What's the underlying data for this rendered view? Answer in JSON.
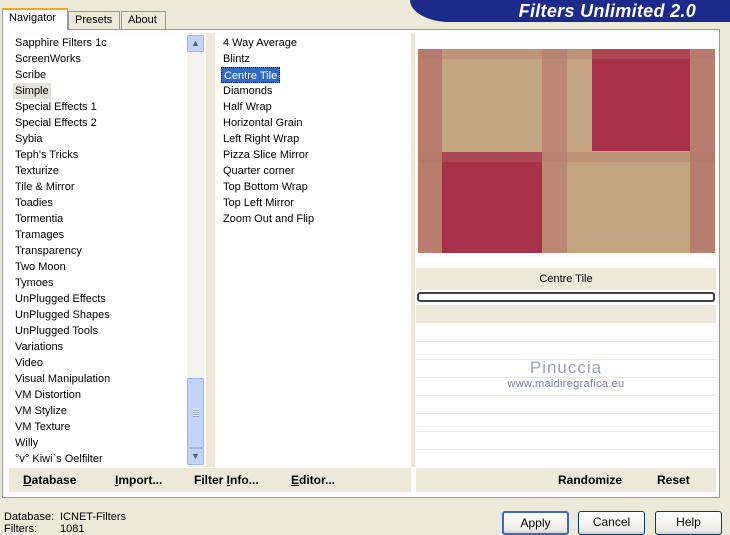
{
  "banner": {
    "title": "Filters Unlimited 2.0"
  },
  "tabs": [
    {
      "label": "Navigator"
    },
    {
      "label": "Presets"
    },
    {
      "label": "About"
    }
  ],
  "categories": {
    "selected": "Simple",
    "items": [
      "Sapphire Filters 1c",
      "ScreenWorks",
      "Scribe",
      "Simple",
      "Special Effects 1",
      "Special Effects 2",
      "Sybia",
      "Teph's Tricks",
      "Texturize",
      "Tile & Mirror",
      "Toadies",
      "Tormentia",
      "Tramages",
      "Transparency",
      "Two Moon",
      "Tymoes",
      "UnPlugged Effects",
      "UnPlugged Shapes",
      "UnPlugged Tools",
      "Variations",
      "Video",
      "Visual Manipulation",
      "VM Distortion",
      "VM Stylize",
      "VM Texture",
      "Willy",
      "°v° Kiwi`s Oelfilter"
    ]
  },
  "filters": {
    "selected": "Centre Tile",
    "items": [
      "4 Way Average",
      "Blintz",
      "Centre Tile",
      "Diamonds",
      "Half Wrap",
      "Horizontal Grain",
      "Left Right Wrap",
      "Pizza Slice Mirror",
      "Quarter corner",
      "Top Bottom Wrap",
      "Top Left Mirror",
      "Zoom Out and Flip"
    ]
  },
  "scrollbar": {
    "up_icon": "▲",
    "down_icon": "▼"
  },
  "preview": {
    "filter_name": "Centre Tile",
    "colors": {
      "tan": "#c4a582",
      "crimson": "#a83048",
      "dusty_rose": "#b5756a"
    }
  },
  "watermark": {
    "name": "Pinuccia",
    "url": "www.maidiregrafica.eu"
  },
  "toolbar_left": {
    "database": {
      "label": "Database",
      "accel": "D",
      "rest": "atabase"
    },
    "import": {
      "label": "Import...",
      "accel": "I",
      "rest": "mport..."
    },
    "filter_info": {
      "label": "Filter Info...",
      "prefix": "Filter ",
      "accel": "I",
      "rest": "nfo..."
    },
    "editor": {
      "label": "Editor...",
      "accel": "E",
      "rest": "ditor..."
    }
  },
  "toolbar_right": {
    "randomize": "Randomize",
    "reset": "Reset"
  },
  "status": {
    "database_label": "Database:",
    "database_value": "ICNET-Filters",
    "filters_label": "Filters:",
    "filters_value": "1081"
  },
  "buttons": {
    "apply": "Apply",
    "cancel": "Cancel",
    "help": "Help"
  }
}
